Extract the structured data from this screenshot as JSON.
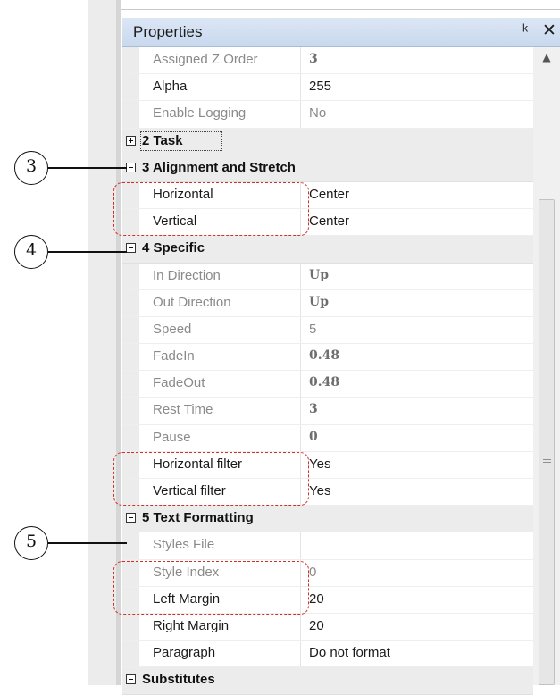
{
  "panel": {
    "title": "Properties",
    "pin_glyph": "p",
    "close_glyph": "✕"
  },
  "rows": {
    "assigned_z_order": {
      "name": "Assigned Z Order",
      "value": "3"
    },
    "alpha": {
      "name": "Alpha",
      "value": "255"
    },
    "enable_logging": {
      "name": "Enable Logging",
      "value": "No"
    },
    "cat_task": {
      "label": "2 Task"
    },
    "cat_alignment": {
      "label": "3 Alignment and Stretch"
    },
    "horizontal": {
      "name": "Horizontal",
      "value": "Center"
    },
    "vertical": {
      "name": "Vertical",
      "value": "Center"
    },
    "cat_specific": {
      "label": "4 Specific"
    },
    "in_direction": {
      "name": "In Direction",
      "value": "Up"
    },
    "out_direction": {
      "name": "Out Direction",
      "value": "Up"
    },
    "speed": {
      "name": "Speed",
      "value": "5"
    },
    "fadein": {
      "name": "FadeIn",
      "value": "0.48"
    },
    "fadeout": {
      "name": "FadeOut",
      "value": "0.48"
    },
    "rest_time": {
      "name": "Rest Time",
      "value": "3"
    },
    "pause": {
      "name": "Pause",
      "value": "0"
    },
    "horizontal_filter": {
      "name": "Horizontal filter",
      "value": "Yes"
    },
    "vertical_filter": {
      "name": "Vertical filter",
      "value": "Yes"
    },
    "cat_text_formatting": {
      "label": "5 Text Formatting"
    },
    "styles_file": {
      "name": "Styles File",
      "value": ""
    },
    "style_index": {
      "name": "Style Index",
      "value": "0"
    },
    "left_margin": {
      "name": "Left Margin",
      "value": "20"
    },
    "right_margin": {
      "name": "Right Margin",
      "value": "20"
    },
    "paragraph": {
      "name": "Paragraph",
      "value": "Do not format"
    },
    "cat_substitutes": {
      "label": "Substitutes"
    }
  },
  "callouts": {
    "c3": "3",
    "c4": "4",
    "c5": "5"
  },
  "colors": {
    "highlight_dash": "#d0302a",
    "category_bg": "#ececec",
    "readonly_text": "#8a8a8a"
  }
}
